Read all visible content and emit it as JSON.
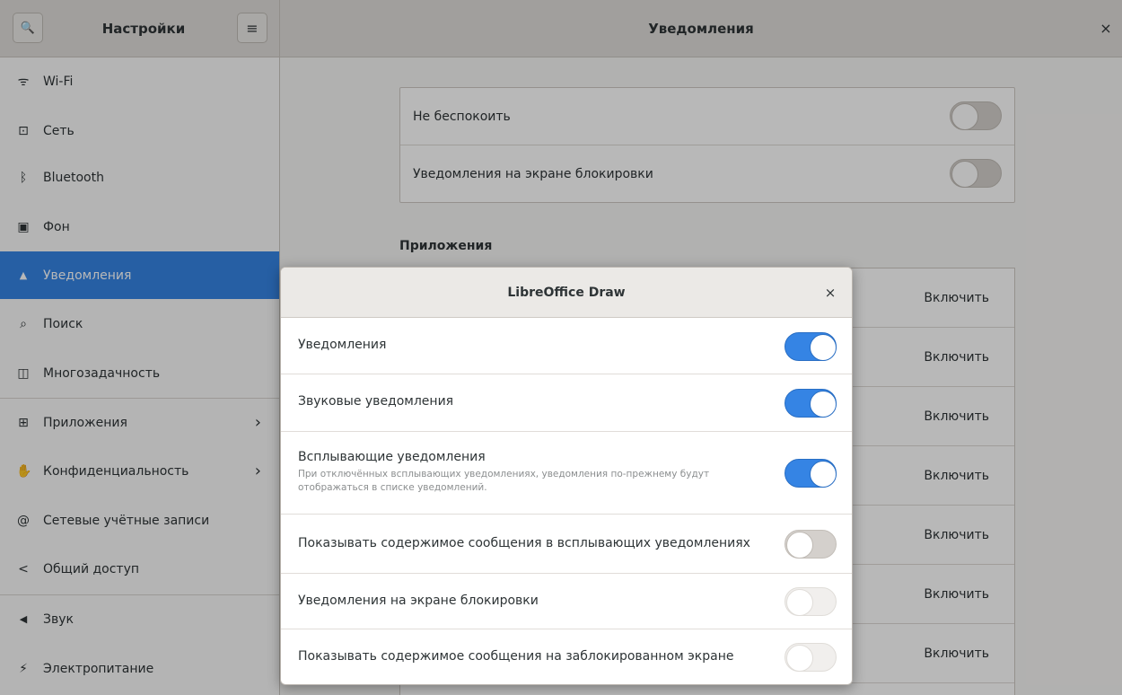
{
  "header": {
    "left_title": "Настройки",
    "right_title": "Уведомления",
    "search_icon": "🔍",
    "menu_icon": "≡",
    "close_icon": "×"
  },
  "sidebar": {
    "items": [
      {
        "label": "Wi-Fi",
        "icon": "wifi-icon",
        "glyph": "ᯤ"
      },
      {
        "label": "Сеть",
        "icon": "network-icon",
        "glyph": "⊡"
      },
      {
        "label": "Bluetooth",
        "icon": "bluetooth-icon",
        "glyph": "ᛒ"
      },
      {
        "label": "Фон",
        "icon": "background-icon",
        "glyph": "▣"
      },
      {
        "label": "Уведомления",
        "icon": "bell-icon",
        "glyph": "▲"
      },
      {
        "label": "Поиск",
        "icon": "search-icon",
        "glyph": "⌕"
      },
      {
        "label": "Многозадачность",
        "icon": "multitasking-icon",
        "glyph": "◫"
      },
      {
        "label": "Приложения",
        "icon": "apps-icon",
        "glyph": "⊞"
      },
      {
        "label": "Конфиденциальность",
        "icon": "hand-icon",
        "glyph": "✋"
      },
      {
        "label": "Сетевые учётные записи",
        "icon": "at-icon",
        "glyph": "@"
      },
      {
        "label": "Общий доступ",
        "icon": "share-icon",
        "glyph": "<"
      },
      {
        "label": "Звук",
        "icon": "speaker-icon",
        "glyph": "◀"
      },
      {
        "label": "Электропитание",
        "icon": "power-icon",
        "glyph": "⚡"
      }
    ],
    "chevron": "›"
  },
  "main": {
    "dnd_label": "Не беспокоить",
    "dnd_on": false,
    "lock_label": "Уведомления на экране блокировки",
    "lock_on": false,
    "apps_title": "Приложения",
    "apps_state": [
      "Включить",
      "Включить",
      "Включить",
      "Включить",
      "Включить",
      "Включить",
      "Включить"
    ]
  },
  "dialog": {
    "title": "LibreOffice Draw",
    "close_icon": "×",
    "rows": [
      {
        "label": "Уведомления",
        "sub": "",
        "state": "on"
      },
      {
        "label": "Звуковые уведомления",
        "sub": "",
        "state": "on"
      },
      {
        "label": "Всплывающие уведомления",
        "sub": "При отключённых всплывающих уведомлениях, уведомления по-прежнему будут отображаться в списке уведомлений.",
        "state": "on"
      },
      {
        "label": "Показывать содержимое сообщения в всплывающих уведомлениях",
        "sub": "",
        "state": "off"
      },
      {
        "label": "Уведомления на экране блокировки",
        "sub": "",
        "state": "disabled"
      },
      {
        "label": "Показывать содержимое сообщения на заблокированном экране",
        "sub": "",
        "state": "disabled"
      }
    ]
  },
  "colors": {
    "accent": "#3584e4",
    "header": "#e0ddda",
    "sidebar": "#fafafa"
  }
}
